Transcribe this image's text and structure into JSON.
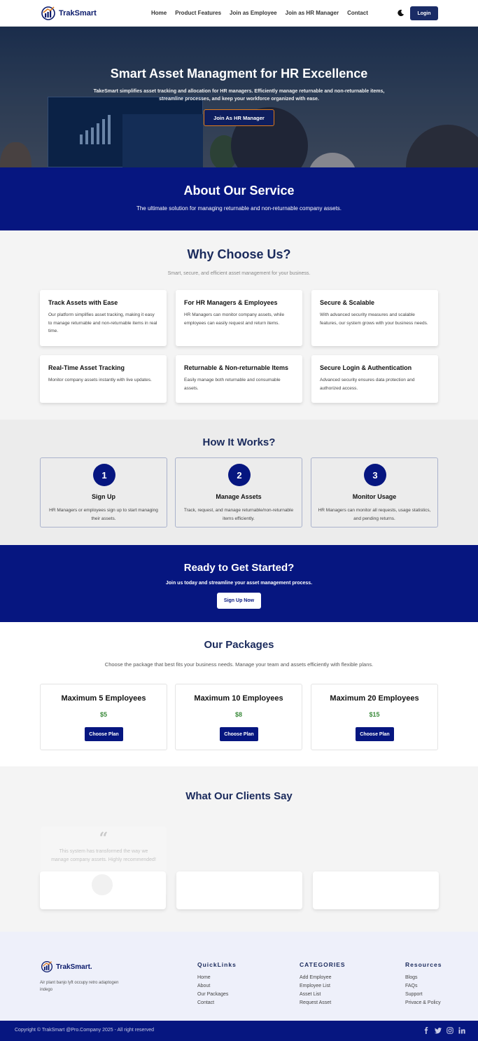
{
  "nav": {
    "brand": "TrakSmart",
    "links": [
      "Home",
      "Product Features",
      "Join as Employee",
      "Join as HR Manager",
      "Contact"
    ],
    "theme_icon": "moon-icon",
    "login_label": "Login"
  },
  "hero": {
    "title": "Smart Asset Managment for HR Excellence",
    "subtitle": "TakeSmart simplifies asset tracking and allocation for HR managers. Efficiently manage returnable and non-returnable items, streamline processes, and keep your workforce organized with ease.",
    "button_label": "Join As HR Manager"
  },
  "about": {
    "title": "About Our Service",
    "subtitle": "The ultimate solution for managing returnable and non-returnable company assets."
  },
  "why": {
    "title": "Why Choose Us?",
    "subtitle": "Smart, secure, and efficient asset management for your business.",
    "cards": [
      {
        "title": "Track Assets with Ease",
        "text": "Our platform simplifies asset tracking, making it easy to manage returnable and non-returnable items in real time."
      },
      {
        "title": "For HR Managers & Employees",
        "text": "HR Managers can monitor company assets, while employees can easily request and return items."
      },
      {
        "title": "Secure & Scalable",
        "text": "With advanced security measures and scalable features, our system grows with your business needs."
      },
      {
        "title": "Real-Time Asset Tracking",
        "text": "Monitor company assets instantly with live updates."
      },
      {
        "title": "Returnable & Non-returnable Items",
        "text": "Easily manage both returnable and consumable assets."
      },
      {
        "title": "Secure Login & Authentication",
        "text": "Advanced security ensures data protection and authorized access."
      }
    ]
  },
  "how": {
    "title": "How It Works?",
    "steps": [
      {
        "num": "1",
        "title": "Sign Up",
        "text": "HR Managers or employees sign up to start managing their assets."
      },
      {
        "num": "2",
        "title": "Manage Assets",
        "text": "Track, request, and manage returnable/non-returnable items efficiently."
      },
      {
        "num": "3",
        "title": "Monitor Usage",
        "text": "HR Managers can monitor all requests, usage statistics, and pending returns."
      }
    ]
  },
  "ready": {
    "title": "Ready to Get Started?",
    "subtitle": "Join us today and streamline your asset management process.",
    "button_label": "Sign Up Now"
  },
  "packages": {
    "title": "Our Packages",
    "subtitle": "Choose the package that best fits your business needs. Manage your team and assets efficiently with flexible plans.",
    "items": [
      {
        "title": "Maximum 5 Employees",
        "price": "$5",
        "button_label": "Choose Plan"
      },
      {
        "title": "Maximum 10 Employees",
        "price": "$8",
        "button_label": "Choose Plan"
      },
      {
        "title": "Maximum 20 Employees",
        "price": "$15",
        "button_label": "Choose Plan"
      }
    ]
  },
  "clients": {
    "title": "What Our Clients Say",
    "quote_mark": "“",
    "testimonial": "This system has transformed the way we manage company assets. Highly recommended!"
  },
  "footer": {
    "brand": "TrakSmart.",
    "description": "Air plant banjo lyft occupy retro adaptogen indego",
    "quicklinks": {
      "title": "QuickLinks",
      "items": [
        "Home",
        "About",
        "Our Packages",
        "Contact"
      ]
    },
    "categories": {
      "title": "CATEGORIES",
      "items": [
        "Add Employee",
        "Employee List",
        "Asset List",
        "Request Asset"
      ]
    },
    "resources": {
      "title": "Resources",
      "items": [
        "Blogs",
        "FAQs",
        "Support",
        "Privace & Policy"
      ]
    },
    "copyright": "Copyright © TrakSmart @Pro.Company 2025 - All right reserved",
    "social_icons": [
      "facebook-icon",
      "twitter-icon",
      "instagram-icon",
      "linkedin-icon"
    ]
  },
  "colors": {
    "navy": "#061680",
    "accent": "#e07a1a",
    "price": "#3a8a3a",
    "heading": "#1a2a5c"
  }
}
